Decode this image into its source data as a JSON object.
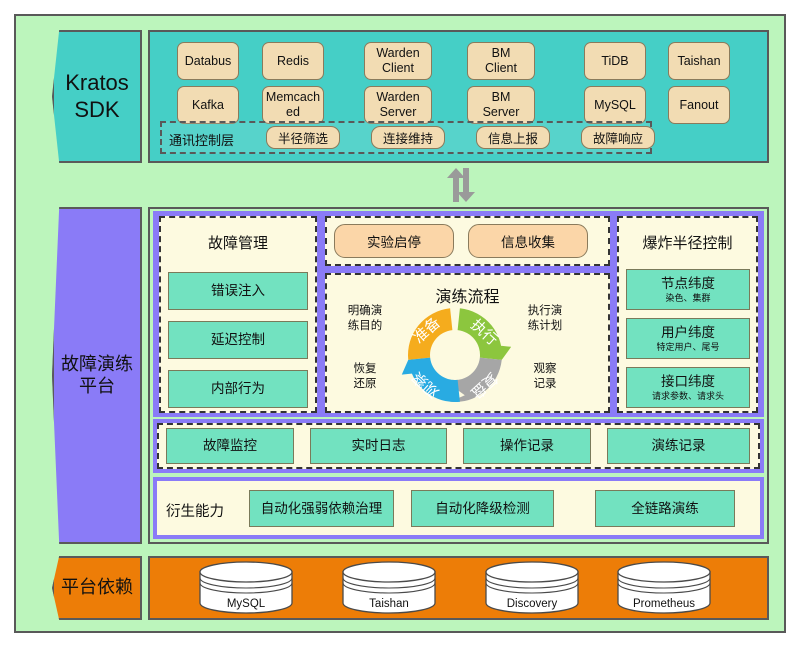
{
  "diagram": {
    "title": "Kratos SDK / 故障演练平台 架构图",
    "colors": {
      "frame_bg": "#bcf5bc",
      "sdk_teal": "#45cfc6",
      "platform_purple": "#8a7bf7",
      "dependency_orange": "#ed7d07",
      "component_tan": "#f2dcb3",
      "mint": "#72e2c0",
      "peach": "#fbd6a8",
      "panel_cream": "#fdfae0",
      "wheel_prepare": "#f5ac1d",
      "wheel_execute": "#8cc63e",
      "wheel_review": "#a6a6a6",
      "wheel_observe": "#29abe2",
      "arrow_gray": "#9a9a9a"
    }
  },
  "layers": {
    "sdk": {
      "tag": "Kratos\nSDK",
      "components_row1": [
        "Databus",
        "Redis",
        "Warden\nClient",
        "BM\nClient",
        "TiDB",
        "Taishan"
      ],
      "components_row2": [
        "Kafka",
        "Memcach\ned",
        "Warden\nServer",
        "BM\nServer",
        "MySQL",
        "Fanout"
      ],
      "control_layer_label": "通讯控制层",
      "control_layer_items": [
        "半径筛选",
        "连接维持",
        "信息上报",
        "故障响应"
      ]
    },
    "platform": {
      "tag": "故障演练\n平台",
      "fault_management": {
        "title": "故障管理",
        "items": [
          "错误注入",
          "延迟控制",
          "内部行为"
        ]
      },
      "experiment_controls": [
        "实验启停",
        "信息收集"
      ],
      "blast_radius": {
        "title": "爆炸半径控制",
        "items": [
          {
            "label": "节点纬度",
            "sub": "染色、集群"
          },
          {
            "label": "用户纬度",
            "sub": "特定用户、尾号"
          },
          {
            "label": "接口纬度",
            "sub": "请求参数、请求头"
          }
        ]
      },
      "monitoring_row": [
        "故障监控",
        "实时日志",
        "操作记录",
        "演练记录"
      ],
      "derived": {
        "label": "衍生能力",
        "items": [
          "自动化强弱依赖治理",
          "自动化降级检测",
          "全链路演练"
        ]
      }
    },
    "dependencies": {
      "tag": "平台依赖",
      "items": [
        "MySQL",
        "Taishan",
        "Discovery",
        "Prometheus"
      ]
    }
  },
  "chart_data": {
    "type": "pie",
    "title": "演练流程",
    "categories": [
      "准备",
      "执行",
      "复盘",
      "观察"
    ],
    "values": [
      25,
      25,
      25,
      25
    ],
    "colors": [
      "#f5ac1d",
      "#8cc63e",
      "#a6a6a6",
      "#29abe2"
    ],
    "annotations": [
      {
        "position": "top-left",
        "text": "明确演\n练目的"
      },
      {
        "position": "top-right",
        "text": "执行演\n练计划"
      },
      {
        "position": "bottom-right",
        "text": "观察\n记录"
      },
      {
        "position": "bottom-left",
        "text": "恢复\n还原"
      }
    ],
    "legend": "none",
    "grid": false
  }
}
